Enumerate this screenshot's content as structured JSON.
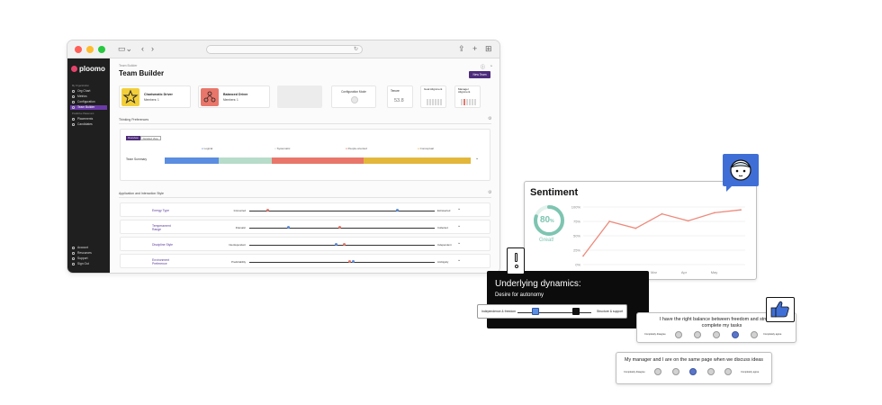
{
  "browser": {
    "icons": {
      "sidebar": "sidebar-icon",
      "back": "chevron-left-icon",
      "forward": "chevron-right-icon",
      "reload": "reload-icon",
      "share": "share-icon",
      "new_tab": "plus-icon",
      "tabs": "tabs-icon"
    }
  },
  "sidebar": {
    "logo": "ploomo",
    "section1": "My Organization",
    "items1": [
      {
        "label": "Org Chart",
        "icon": "org-chart-icon"
      },
      {
        "label": "Metrics",
        "icon": "metrics-icon"
      },
      {
        "label": "Configuration",
        "icon": "pencil-icon"
      },
      {
        "label": "Team Builder",
        "icon": "team-icon",
        "active": true
      }
    ],
    "section2": "Predictive Placement",
    "items2": [
      {
        "label": "Placements",
        "icon": "placements-icon"
      },
      {
        "label": "Candidates",
        "icon": "candidates-icon"
      }
    ],
    "footer": [
      {
        "label": "Account",
        "icon": "account-icon"
      },
      {
        "label": "Resources",
        "icon": "resources-icon"
      },
      {
        "label": "Support",
        "icon": "support-icon"
      },
      {
        "label": "Sign Out",
        "icon": "sign-out-icon"
      }
    ]
  },
  "main": {
    "breadcrumb": "Team Builder",
    "title": "Team Builder",
    "new_team": "New Team",
    "drivers": [
      {
        "name": "Charismatic Driver",
        "members": "Members: 1",
        "color": "#f2cf3a"
      },
      {
        "name": "Balanced Driver",
        "members": "Members: 1",
        "color": "#e8766a"
      }
    ],
    "config_title": "Configuration Mode",
    "tenure_label": "Tenure",
    "tenure_value": "53.8",
    "goal_label": "Goal Alignment",
    "manager_label": "Manager Alignment",
    "thinking_title": "Thinking Preferences",
    "tabs": [
      "Overview",
      "Detailed View"
    ],
    "legend": [
      "Logical",
      "Systematic",
      "People-oriented",
      "Conceptual"
    ],
    "legend_colors": [
      "#5b8de0",
      "#b7dcc9",
      "#e8766a",
      "#e3b73a"
    ],
    "team_summary": "Team Summary",
    "summary_shares": [
      0.17,
      0.17,
      0.29,
      0.34
    ],
    "style_title": "Application and Interaction Style",
    "rows": [
      {
        "label": "Energy Type",
        "left": "Introverted",
        "right": "Extraverted",
        "p1": 0.1,
        "c1": "#e8766a",
        "p2": 0.8,
        "c2": "#5b8de0"
      },
      {
        "label": "Temperament Range",
        "left": "Dramatic",
        "right": "Collected",
        "p1": 0.21,
        "c1": "#5b8de0",
        "p2": 0.49,
        "c2": "#e8766a"
      },
      {
        "label": "Discipline Style",
        "left": "Interdependent",
        "right": "Independent",
        "p1": 0.47,
        "c1": "#5b8de0",
        "p2": 0.51,
        "c2": "#e8766a"
      },
      {
        "label": "Environment Preference",
        "left": "Predictability",
        "right": "Ambiguity",
        "p1": 0.54,
        "c1": "#e8766a",
        "p2": 0.56,
        "c2": "#5b8de0"
      }
    ]
  },
  "sentiment": {
    "title": "Sentiment",
    "score": "80",
    "score_unit": "%",
    "score_label": "Great!",
    "score_color": "#7ec5b1",
    "line_color": "#ee8a7c",
    "badge_color": "#3f6fd6",
    "chart_data": {
      "type": "line",
      "categories": [
        "Jan",
        "Feb",
        "Mar",
        "Apr",
        "May"
      ],
      "values": [
        15,
        75,
        63,
        88,
        76,
        90,
        95
      ],
      "y_ticks": [
        "100%",
        "75%",
        "50%",
        "25%",
        "0%"
      ],
      "x_labels": [
        "Feb",
        "Mar",
        "Apr",
        "May"
      ],
      "ylim": [
        0,
        100
      ]
    }
  },
  "dynamics": {
    "title": "Underlying dynamics:",
    "subtitle": "Desire for autonomy",
    "left_label": "Independence & freedom",
    "right_label": "Structure & support",
    "icon": "exclamation-icon"
  },
  "survey1": {
    "question": "I have the right balance between freedom and structure to complete my tasks",
    "left": "Completely disagree",
    "right": "Completely agree",
    "selected": 3,
    "icon": "thumbs-up-icon"
  },
  "survey2": {
    "question": "My manager and I are on the same page when we discuss ideas",
    "left": "Completely disagree",
    "right": "Completely agree",
    "selected": 2
  }
}
